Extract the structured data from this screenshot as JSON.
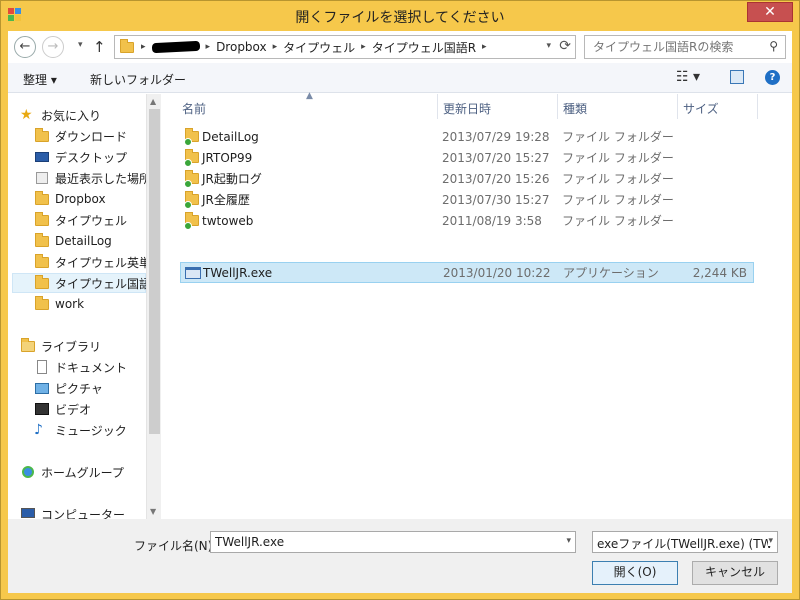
{
  "window": {
    "title": "開くファイルを選択してください",
    "close_label": "✕"
  },
  "address": {
    "crumbs": [
      "Dropbox",
      "タイプウェル",
      "タイプウェル国語R"
    ],
    "sep": "▸"
  },
  "search": {
    "placeholder": "タイプウェル国語Rの検索"
  },
  "toolbar": {
    "organize": "整理 ▾",
    "new_folder": "新しいフォルダー"
  },
  "nav": {
    "favorites": "お気に入り",
    "downloads": "ダウンロード",
    "desktop": "デスクトップ",
    "recent": "最近表示した場所",
    "dropbox": "Dropbox",
    "typewell": "タイプウェル",
    "detaillog": "DetailLog",
    "typewell_en": "タイプウェル英単語",
    "typewell_kokugo": "タイプウェル国語R",
    "work": "work",
    "libraries": "ライブラリ",
    "documents": "ドキュメント",
    "pictures": "ピクチャ",
    "videos": "ビデオ",
    "music": "ミュージック",
    "homegroup": "ホームグループ",
    "computer": "コンピューター"
  },
  "columns": {
    "name": "名前",
    "date": "更新日時",
    "type": "種類",
    "size": "サイズ"
  },
  "files": [
    {
      "name": "DetailLog",
      "date": "2013/07/29 19:28",
      "type": "ファイル フォルダー",
      "size": ""
    },
    {
      "name": "JRTOP99",
      "date": "2013/07/20 15:27",
      "type": "ファイル フォルダー",
      "size": ""
    },
    {
      "name": "JR起動ログ",
      "date": "2013/07/20 15:26",
      "type": "ファイル フォルダー",
      "size": ""
    },
    {
      "name": "JR全履歴",
      "date": "2013/07/30 15:27",
      "type": "ファイル フォルダー",
      "size": ""
    },
    {
      "name": "twtoweb",
      "date": "2011/08/19 3:58",
      "type": "ファイル フォルダー",
      "size": ""
    },
    {
      "name": "TWellJR.exe",
      "date": "2013/01/20 10:22",
      "type": "アプリケーション",
      "size": "2,244 KB"
    }
  ],
  "bottom": {
    "filename_label": "ファイル名(N):",
    "filename_value": "TWellJR.exe",
    "filter": "exeファイル(TWellJR.exe) (TW",
    "open": "開く(O)",
    "cancel": "キャンセル"
  }
}
